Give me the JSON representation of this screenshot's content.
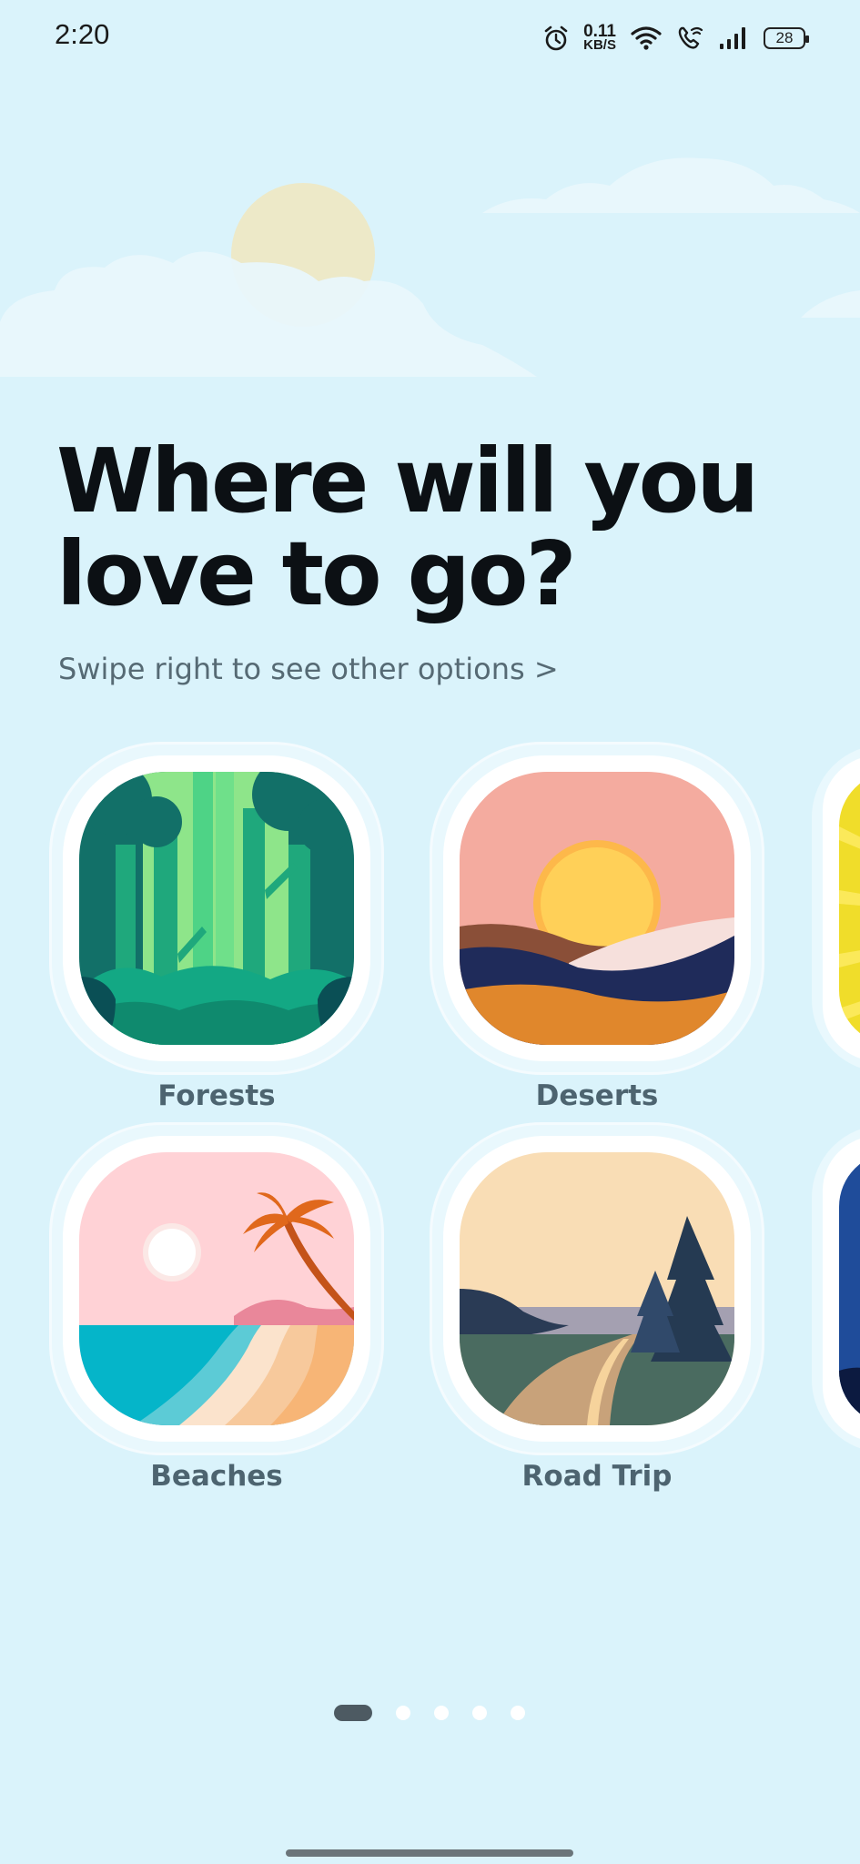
{
  "status_bar": {
    "time": "2:20",
    "net_speed_value": "0.11",
    "net_speed_unit": "KB/S",
    "battery": "28"
  },
  "headline": "Where will you love to go?",
  "subtitle": "Swipe right to see other options >",
  "categories": [
    {
      "label": "Forests",
      "icon": "forest-illustration"
    },
    {
      "label": "Deserts",
      "icon": "desert-illustration"
    },
    {
      "label": "Beaches",
      "icon": "beach-illustration"
    },
    {
      "label": "Road Trip",
      "icon": "road-trip-illustration"
    }
  ],
  "pagination": {
    "pages": 5,
    "current": 1
  },
  "colors": {
    "background": "#daf3fb",
    "headline": "#0c1014",
    "label": "#4d6470",
    "active_dot": "#4d5a62"
  }
}
